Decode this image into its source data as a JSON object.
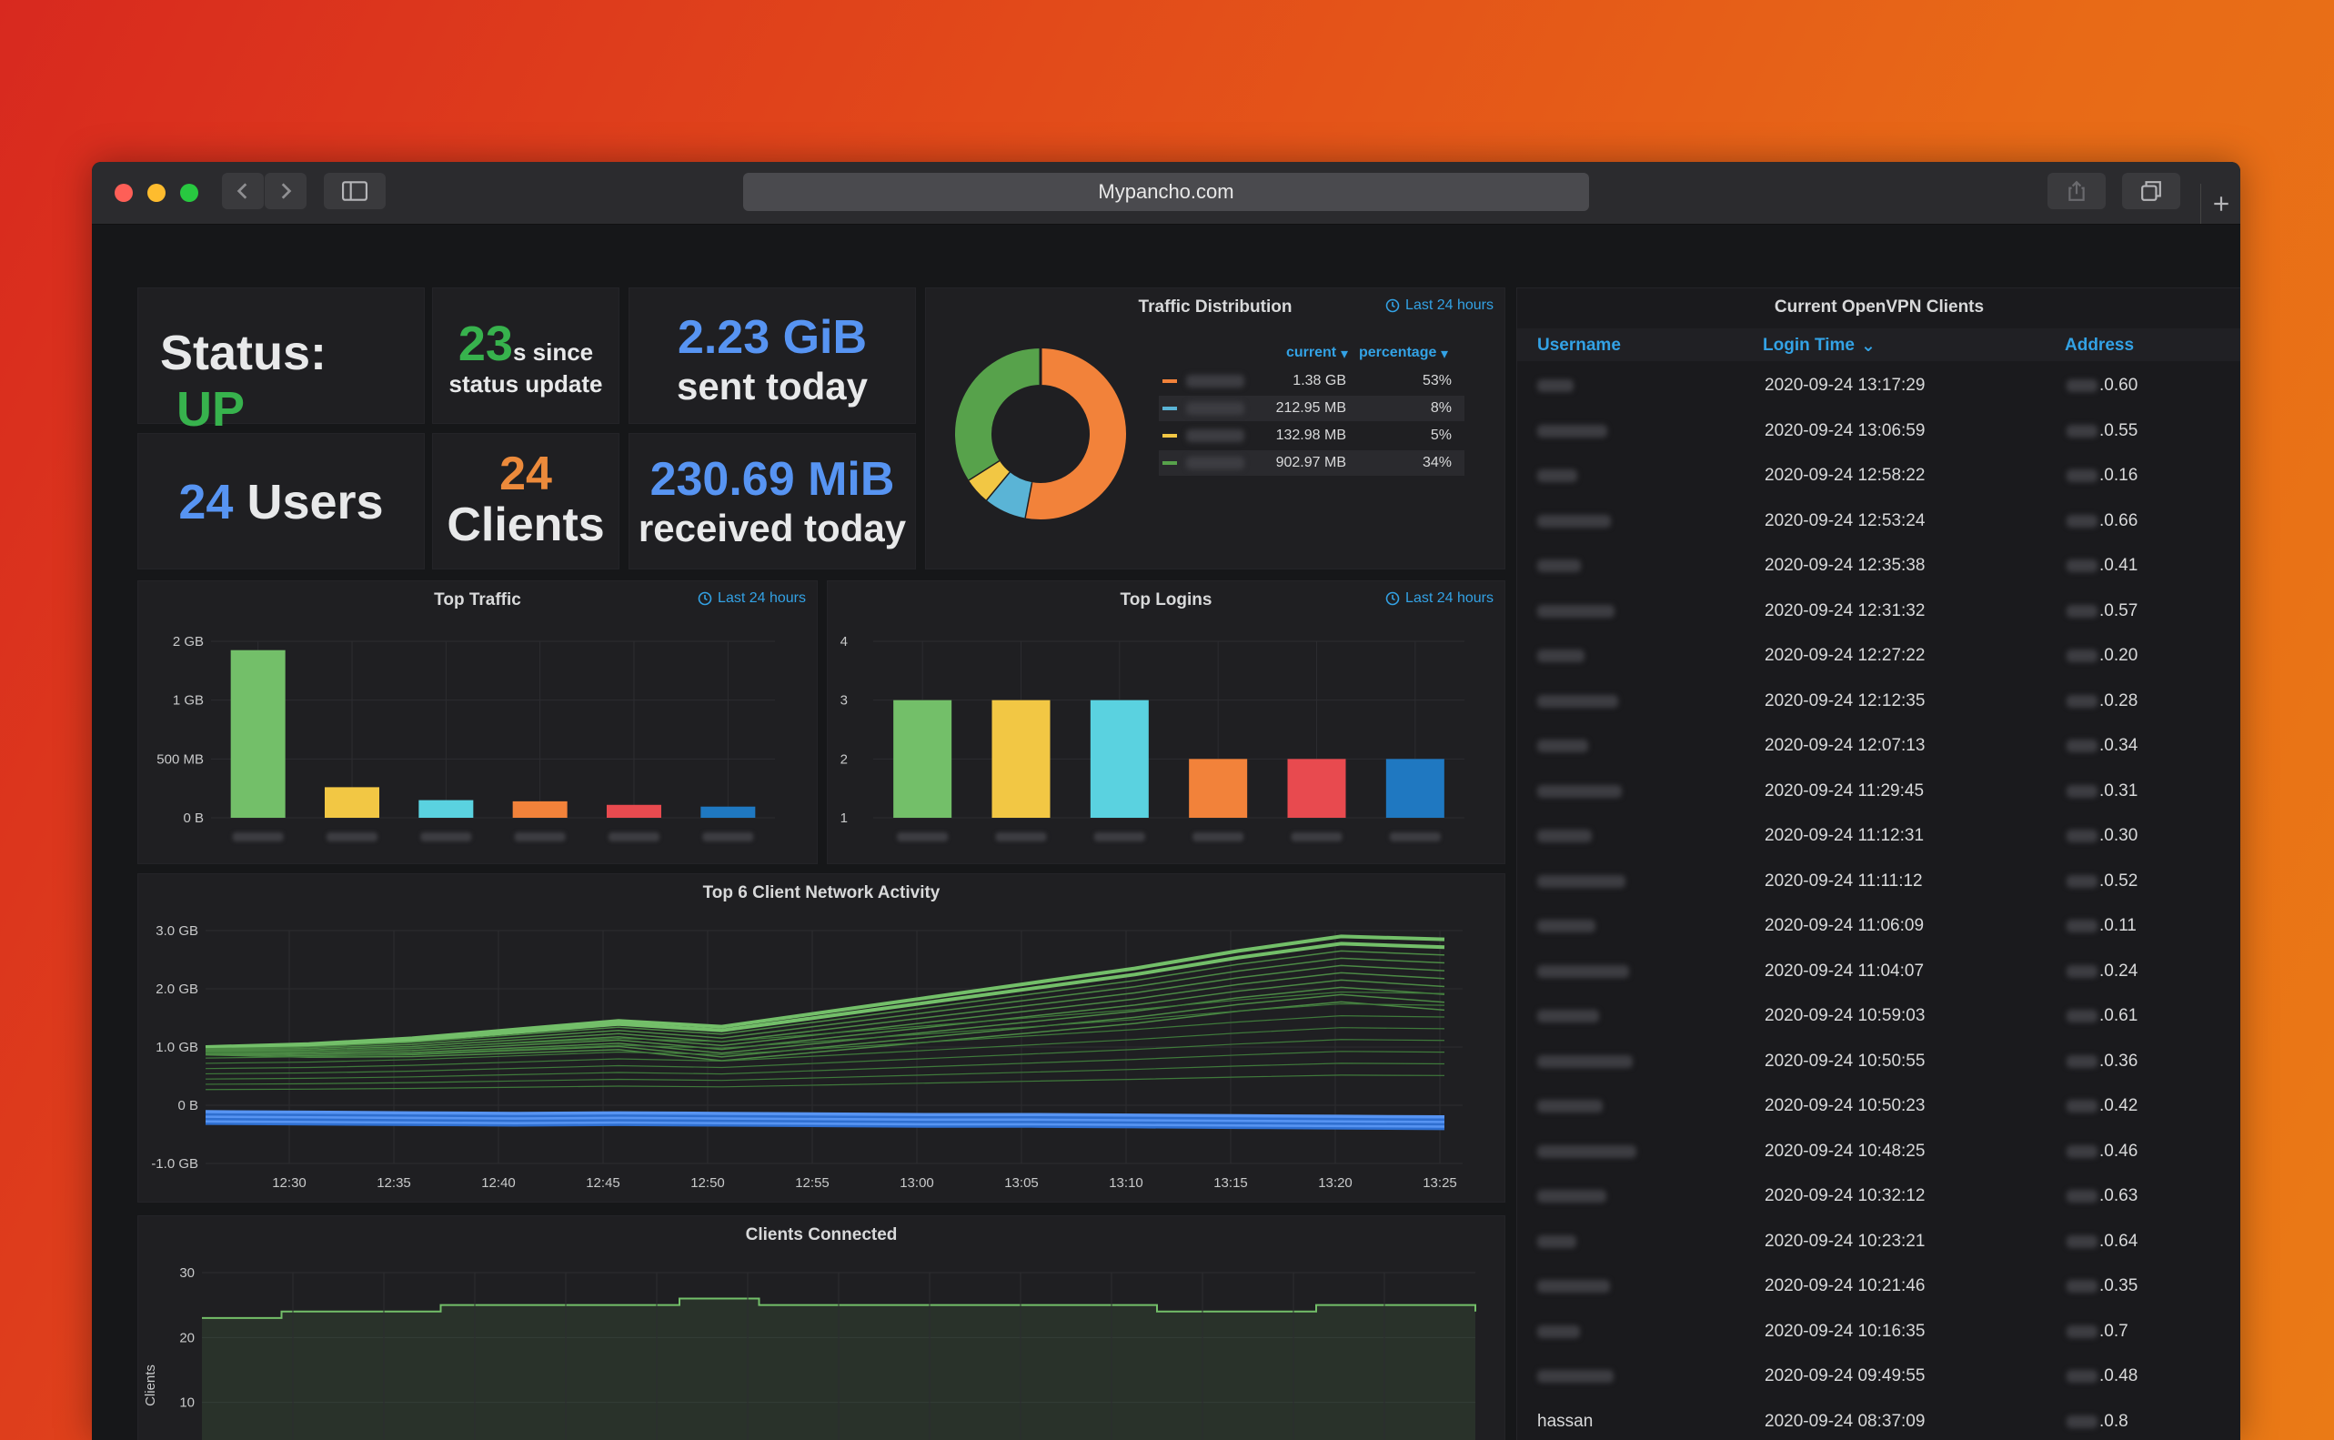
{
  "browser": {
    "url": "Mypancho.com"
  },
  "stats": {
    "status_label": "Status:",
    "status_value": "UP",
    "since_value": "23",
    "since_unit": "s since",
    "since_caption": "status update",
    "sent_value": "2.23 GiB",
    "sent_caption": "sent today",
    "users_value": "24",
    "users_caption": "Users",
    "clients_value": "24",
    "clients_caption": "Clients",
    "received_value": "230.69 MiB",
    "received_caption": "received today"
  },
  "colors": {
    "green": "#73bf69",
    "yellow": "#f2c744",
    "cyan": "#5ad2e0",
    "orange": "#f2823a",
    "red": "#e84a4f",
    "blue": "#1f78c1",
    "link": "#33a2e5",
    "status_up": "#37b24d",
    "stat_blue": "#5794f2",
    "stat_orange": "#ec8a3b"
  },
  "traffic_distribution": {
    "title": "Traffic Distribution",
    "range": "Last 24 hours",
    "col_current": "current",
    "col_percentage": "percentage",
    "rows": [
      {
        "color": "#f2823a",
        "current": "1.38 GB",
        "percentage": "53%"
      },
      {
        "color": "#5ab4d6",
        "current": "212.95 MB",
        "percentage": "8%"
      },
      {
        "color": "#f2c744",
        "current": "132.98 MB",
        "percentage": "5%"
      },
      {
        "color": "#57a24b",
        "current": "902.97 MB",
        "percentage": "34%"
      }
    ]
  },
  "top_traffic": {
    "title": "Top Traffic",
    "range": "Last 24 hours",
    "y_ticks": [
      "2 GB",
      "1 GB",
      "500 MB",
      "0 B"
    ]
  },
  "top_logins": {
    "title": "Top Logins",
    "range": "Last 24 hours",
    "y_ticks": [
      "4",
      "3",
      "2",
      "1"
    ]
  },
  "network_activity": {
    "title": "Top 6 Client Network Activity",
    "y_ticks": [
      "3.0 GB",
      "2.0 GB",
      "1.0 GB",
      "0 B",
      "-1.0 GB"
    ],
    "x_ticks": [
      "12:30",
      "12:35",
      "12:40",
      "12:45",
      "12:50",
      "12:55",
      "13:00",
      "13:05",
      "13:10",
      "13:15",
      "13:20",
      "13:25"
    ]
  },
  "clients_connected": {
    "title": "Clients Connected",
    "y_label": "Clients",
    "y_ticks": [
      "30",
      "20",
      "10"
    ]
  },
  "openvpn": {
    "title": "Current OpenVPN Clients",
    "col_username": "Username",
    "col_login": "Login Time",
    "col_address": "Address",
    "rows": [
      {
        "username": "",
        "login": "2020-09-24 13:17:29",
        "address": ".0.60"
      },
      {
        "username": "",
        "login": "2020-09-24 13:06:59",
        "address": ".0.55"
      },
      {
        "username": "",
        "login": "2020-09-24 12:58:22",
        "address": ".0.16"
      },
      {
        "username": "",
        "login": "2020-09-24 12:53:24",
        "address": ".0.66"
      },
      {
        "username": "",
        "login": "2020-09-24 12:35:38",
        "address": ".0.41"
      },
      {
        "username": "",
        "login": "2020-09-24 12:31:32",
        "address": ".0.57"
      },
      {
        "username": "",
        "login": "2020-09-24 12:27:22",
        "address": ".0.20"
      },
      {
        "username": "",
        "login": "2020-09-24 12:12:35",
        "address": ".0.28"
      },
      {
        "username": "",
        "login": "2020-09-24 12:07:13",
        "address": ".0.34"
      },
      {
        "username": "",
        "login": "2020-09-24 11:29:45",
        "address": ".0.31"
      },
      {
        "username": "",
        "login": "2020-09-24 11:12:31",
        "address": ".0.30"
      },
      {
        "username": "",
        "login": "2020-09-24 11:11:12",
        "address": ".0.52"
      },
      {
        "username": "",
        "login": "2020-09-24 11:06:09",
        "address": ".0.11"
      },
      {
        "username": "",
        "login": "2020-09-24 11:04:07",
        "address": ".0.24"
      },
      {
        "username": "",
        "login": "2020-09-24 10:59:03",
        "address": ".0.61"
      },
      {
        "username": "",
        "login": "2020-09-24 10:50:55",
        "address": ".0.36"
      },
      {
        "username": "",
        "login": "2020-09-24 10:50:23",
        "address": ".0.42"
      },
      {
        "username": "",
        "login": "2020-09-24 10:48:25",
        "address": ".0.46"
      },
      {
        "username": "",
        "login": "2020-09-24 10:32:12",
        "address": ".0.63"
      },
      {
        "username": "",
        "login": "2020-09-24 10:23:21",
        "address": ".0.64"
      },
      {
        "username": "",
        "login": "2020-09-24 10:21:46",
        "address": ".0.35"
      },
      {
        "username": "",
        "login": "2020-09-24 10:16:35",
        "address": ".0.7"
      },
      {
        "username": "",
        "login": "2020-09-24 09:49:55",
        "address": ".0.48"
      },
      {
        "username": "hassan",
        "login": "2020-09-24 08:37:09",
        "address": ".0.8"
      }
    ]
  },
  "chart_data": [
    {
      "type": "pie",
      "title": "Traffic Distribution",
      "values": [
        53,
        8,
        5,
        34
      ],
      "colors": [
        "#f2823a",
        "#5ab4d6",
        "#f2c744",
        "#57a24b"
      ]
    },
    {
      "type": "bar",
      "title": "Top Traffic",
      "values_mb": [
        1850,
        260,
        150,
        140,
        110,
        95
      ],
      "colors": [
        "#73bf69",
        "#f2c744",
        "#5ad2e0",
        "#f2823a",
        "#e84a4f",
        "#1f78c1"
      ],
      "y_ticks_mb": [
        0,
        500,
        1000,
        2000
      ]
    },
    {
      "type": "bar",
      "title": "Top Logins",
      "values": [
        3,
        3,
        3,
        2,
        2,
        2
      ],
      "colors": [
        "#73bf69",
        "#f2c744",
        "#5ad2e0",
        "#f2823a",
        "#e84a4f",
        "#1f78c1"
      ],
      "ylim": [
        1,
        4
      ]
    },
    {
      "type": "line",
      "title": "Top 6 Client Network Activity",
      "ylim_gb": [
        -1,
        3
      ],
      "series": [
        {
          "values": [
            1.0,
            1.05,
            1.15,
            1.3,
            1.45,
            1.35,
            1.6,
            1.85,
            2.1,
            2.35,
            2.65,
            2.9,
            2.85
          ]
        },
        {
          "values": [
            -0.25,
            -0.26,
            -0.27,
            -0.28,
            -0.27,
            -0.28,
            -0.29,
            -0.3,
            -0.3,
            -0.31,
            -0.32,
            -0.33,
            -0.34
          ]
        }
      ]
    },
    {
      "type": "area",
      "title": "Clients Connected",
      "ylim": [
        0,
        30
      ],
      "values": [
        23,
        24,
        24,
        25,
        25,
        25,
        26,
        25,
        25,
        25,
        25,
        25,
        24,
        24,
        25,
        25,
        24
      ]
    }
  ]
}
